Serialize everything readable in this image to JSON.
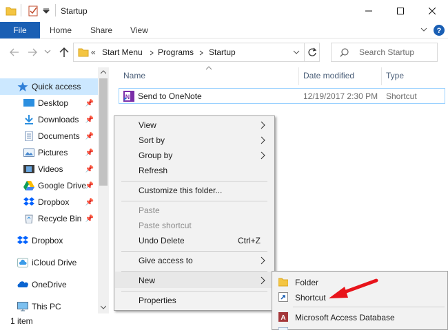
{
  "window": {
    "title": "Startup",
    "minimize_icon": "minimize-icon",
    "maximize_icon": "maximize-icon",
    "close_icon": "close-icon"
  },
  "ribbon": {
    "tabs": [
      "File",
      "Home",
      "Share",
      "View"
    ],
    "expand_icon": "chevron-down-icon",
    "help_icon": "help-icon",
    "accent_color": "#1a5fb4"
  },
  "address": {
    "overflow": "«",
    "breadcrumb": [
      "Start Menu",
      "Programs",
      "Startup"
    ],
    "refresh_icon": "refresh-icon"
  },
  "search": {
    "placeholder": "Search Startup"
  },
  "sidebar": {
    "items": [
      {
        "label": "Quick access",
        "icon": "star-icon",
        "pinned": false
      },
      {
        "label": "Desktop",
        "icon": "desktop-icon",
        "pinned": true
      },
      {
        "label": "Downloads",
        "icon": "download-icon",
        "pinned": true
      },
      {
        "label": "Documents",
        "icon": "document-icon",
        "pinned": true
      },
      {
        "label": "Pictures",
        "icon": "pictures-icon",
        "pinned": true
      },
      {
        "label": "Videos",
        "icon": "videos-icon",
        "pinned": true
      },
      {
        "label": "Google Drive",
        "icon": "google-drive-icon",
        "pinned": true
      },
      {
        "label": "Dropbox",
        "icon": "dropbox-icon",
        "pinned": true
      },
      {
        "label": "Recycle Bin",
        "icon": "recycle-bin-icon",
        "pinned": true
      },
      {
        "label": "Dropbox",
        "icon": "dropbox-icon",
        "pinned": false
      },
      {
        "label": "iCloud Drive",
        "icon": "icloud-icon",
        "pinned": false
      },
      {
        "label": "OneDrive",
        "icon": "onedrive-icon",
        "pinned": false
      },
      {
        "label": "This PC",
        "icon": "pc-icon",
        "pinned": false
      }
    ]
  },
  "file_list": {
    "columns": [
      "Name",
      "Date modified",
      "Type"
    ],
    "rows": [
      {
        "name": "Send to OneNote",
        "date_modified": "12/19/2017 2:30 PM",
        "type": "Shortcut",
        "icon": "onenote-icon"
      }
    ]
  },
  "status": {
    "text": "1 item"
  },
  "context_menu": {
    "items": [
      {
        "label": "View",
        "submenu": true
      },
      {
        "label": "Sort by",
        "submenu": true
      },
      {
        "label": "Group by",
        "submenu": true
      },
      {
        "label": "Refresh"
      },
      {
        "label": "Customize this folder..."
      },
      {
        "label": "Paste",
        "disabled": true
      },
      {
        "label": "Paste shortcut",
        "disabled": true
      },
      {
        "label": "Undo Delete",
        "shortcut": "Ctrl+Z"
      },
      {
        "label": "Give access to",
        "submenu": true
      },
      {
        "label": "New",
        "submenu": true,
        "highlighted": true
      },
      {
        "label": "Properties"
      }
    ]
  },
  "new_submenu": {
    "items": [
      {
        "label": "Folder",
        "icon": "folder-icon"
      },
      {
        "label": "Shortcut",
        "icon": "shortcut-icon"
      },
      {
        "label": "Microsoft Access Database",
        "icon": "access-icon"
      }
    ]
  },
  "annotation": {
    "arrow_color": "#e8141b"
  }
}
